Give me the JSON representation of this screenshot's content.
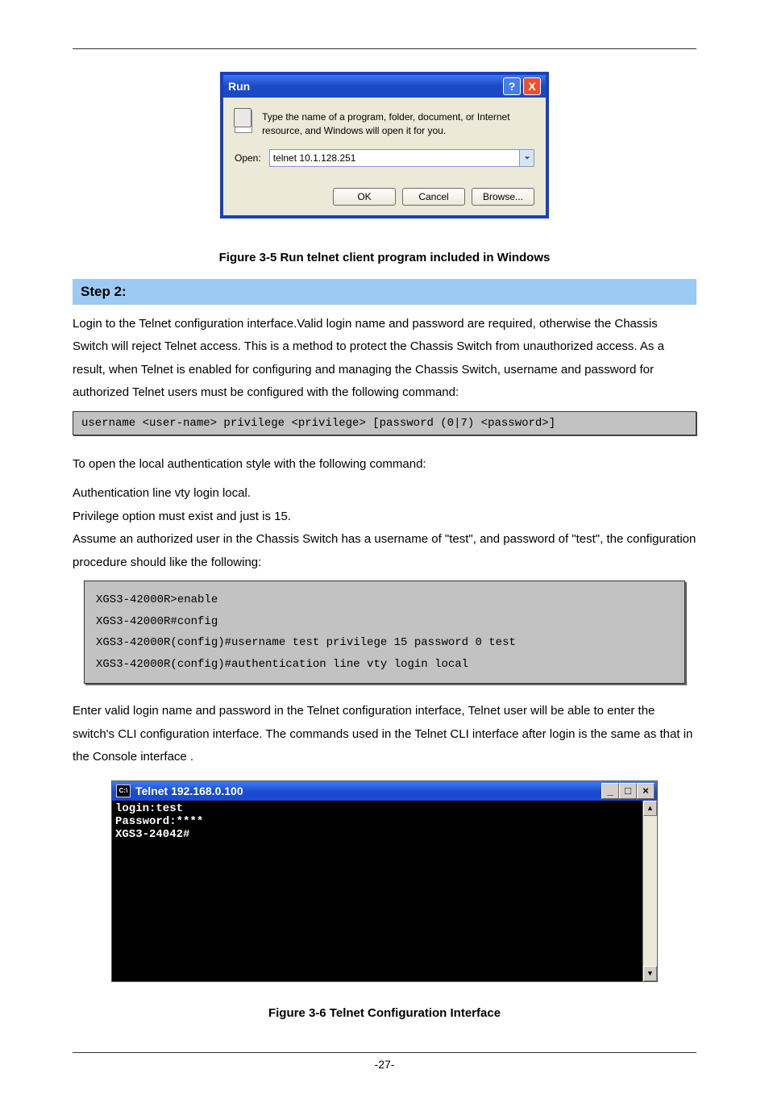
{
  "run_dialog": {
    "title": "Run",
    "description": "Type the name of a program, folder, document, or Internet resource, and Windows will open it for you.",
    "open_label": "Open:",
    "open_value": "telnet 10.1.128.251",
    "ok": "OK",
    "cancel": "Cancel",
    "browse": "Browse..."
  },
  "figure1_caption": "Figure 3-5 Run telnet client program included in Windows",
  "section_bar": "Step 2:",
  "para1": "Login to the Telnet configuration interface.Valid login name and password are required, otherwise the Chassis Switch will reject Telnet access. This is a method to protect the Chassis Switch from unauthorized access. As a result, when Telnet is enabled for configuring and managing the Chassis Switch, username and password for authorized Telnet users must be configured with the following command:",
  "cli1": "username <user-name> privilege <privilege> [password (0|7) <password>]",
  "para2": "To open the local authentication style with the following command:",
  "cli2": "Authentication line vty login local.\nPrivilege option must exist and just is 15.\nAssume an authorized user in the Chassis Switch has a username of \"test\", and password of \"test\", the configuration procedure should like the following:",
  "cli3": "XGS3-42000R>enable\nXGS3-42000R#config\nXGS3-42000R(config)#username test privilege 15 password 0 test\nXGS3-42000R(config)#authentication line vty login local",
  "para3_part1": "Enter valid login name and password in the Telnet configuration interface, Telnet user will be able to enter the switch's CLI configuration interface. The commands used in the Telnet CLI interface after login is the same as that in the Console interface ",
  "para3_part2": ".",
  "telnet_window": {
    "title": "Telnet 192.168.0.100",
    "console": "login:test\nPassword:****\nXGS3-24042#"
  },
  "figure2_caption": "Figure 3-6 Telnet Configuration Interface",
  "page_number": "-27-"
}
